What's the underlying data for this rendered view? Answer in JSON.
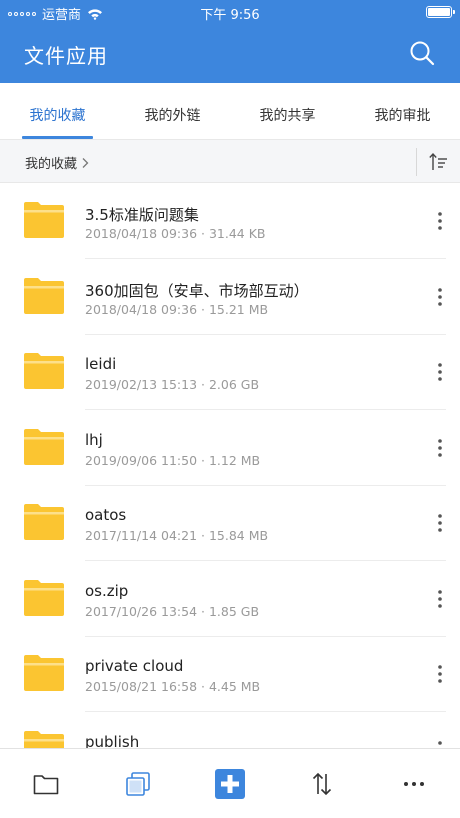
{
  "status_bar": {
    "carrier": "运营商",
    "time": "下午 9:56"
  },
  "header": {
    "title": "文件应用",
    "search_icon": "search-icon"
  },
  "tabs": [
    {
      "label": "我的收藏",
      "active": true
    },
    {
      "label": "我的外链",
      "active": false
    },
    {
      "label": "我的共享",
      "active": false
    },
    {
      "label": "我的审批",
      "active": false
    }
  ],
  "breadcrumb": {
    "label": "我的收藏",
    "sort_icon": "sort-icon"
  },
  "files": [
    {
      "name": "3.5标准版问题集",
      "date": "2018/04/18 09:36",
      "size": "31.44 KB"
    },
    {
      "name": "360加固包（安卓、市场部互动）",
      "date": "2018/04/18 09:36",
      "size": "15.21 MB"
    },
    {
      "name": "leidi",
      "date": "2019/02/13 15:13",
      "size": "2.06 GB"
    },
    {
      "name": "lhj",
      "date": "2019/09/06 11:50",
      "size": "1.12 MB"
    },
    {
      "name": "oatos",
      "date": "2017/11/14 04:21",
      "size": "15.84 MB"
    },
    {
      "name": "os.zip",
      "date": "2017/10/26 13:54",
      "size": "1.85 GB"
    },
    {
      "name": "private cloud",
      "date": "2015/08/21 16:58",
      "size": "4.45 MB"
    },
    {
      "name": "publish",
      "date": "",
      "size": ""
    }
  ],
  "meta_separator": " · ",
  "bottom_bar": [
    "folder-icon",
    "copy-icon",
    "add-icon",
    "transfer-icon",
    "more-icon"
  ],
  "colors": {
    "primary": "#3d86dd",
    "folder": "#fbc531",
    "folder_light": "#fde08a"
  }
}
